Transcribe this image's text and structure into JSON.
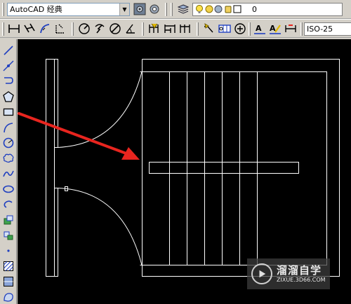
{
  "workspace": {
    "label": "AutoCAD 经典"
  },
  "layer": {
    "name": "0"
  },
  "dimstyle": {
    "label": "ISO-25"
  },
  "watermark": {
    "title": "溜溜自学",
    "url": "ZIXUE.3D66.COM"
  },
  "colors": {
    "toolbar_bg": "#d4d0c8",
    "canvas_bg": "#000000",
    "drawing_lines": "#ffffff",
    "arrow": "#e8251f",
    "icon_blue": "#1f3fbf"
  },
  "icons": {
    "left_toolbar": [
      "line-icon",
      "construction-line-icon",
      "polyline-icon",
      "polygon-icon",
      "rectangle-icon",
      "arc-icon",
      "circle-icon",
      "revision-cloud-icon",
      "spline-icon",
      "ellipse-icon",
      "ellipse-arc-icon",
      "insert-block-icon",
      "make-block-icon",
      "point-icon",
      "hatch-icon",
      "gradient-icon",
      "region-icon"
    ],
    "dimension_toolbar": [
      "linear-dim-icon",
      "aligned-dim-icon",
      "arc-length-dim-icon",
      "ordinate-dim-icon",
      "radius-dim-icon",
      "jogged-dim-icon",
      "diameter-dim-icon",
      "angular-dim-icon",
      "quick-dim-icon",
      "baseline-dim-icon",
      "continue-dim-icon",
      "quick-leader-icon",
      "tolerance-icon",
      "center-mark-icon",
      "dim-edit-icon",
      "dim-text-edit-icon",
      "dim-update-icon"
    ]
  }
}
